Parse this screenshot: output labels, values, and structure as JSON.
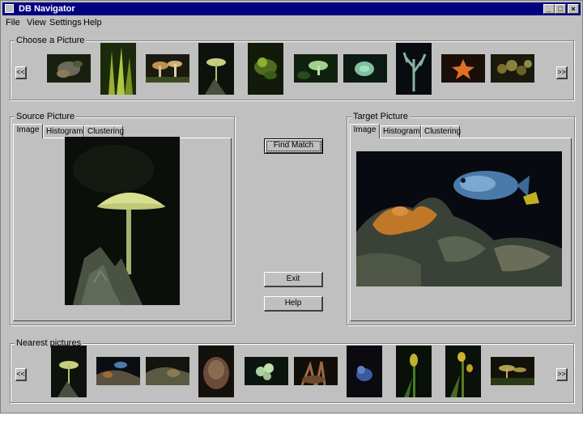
{
  "window": {
    "title": "DB Navigator",
    "controls": {
      "minimize": "_",
      "maximize": "□",
      "close": "×"
    }
  },
  "menu": {
    "items": [
      "File",
      "View",
      "Settings",
      "Help"
    ]
  },
  "choose_group": {
    "label": "Choose a Picture",
    "prev": "<<",
    "next": ">>",
    "thumbnails": [
      "shells",
      "grass",
      "mushrooms",
      "mushroom",
      "plant",
      "mushroom",
      "fungus",
      "coral",
      "starfish",
      "moss"
    ]
  },
  "source": {
    "label": "Source Picture",
    "tabs": [
      "Image",
      "Histogram",
      "Clustering"
    ],
    "active_tab": "Image"
  },
  "target": {
    "label": "Target Picture",
    "tabs": [
      "Image",
      "Histogram",
      "Clustering"
    ],
    "active_tab": "Image"
  },
  "buttons": {
    "find_match": "Find Match",
    "exit": "Exit",
    "help": "Help"
  },
  "nearest_group": {
    "label": "Nearest pictures",
    "prev": "<<",
    "next": ">>",
    "thumbnails": [
      "mushroom",
      "fish",
      "reef",
      "shell",
      "coral",
      "plant",
      "bird",
      "flower",
      "flower",
      "mushrooms"
    ]
  },
  "colors": {
    "titlebar": "#000080",
    "face": "#c0c0c0"
  }
}
